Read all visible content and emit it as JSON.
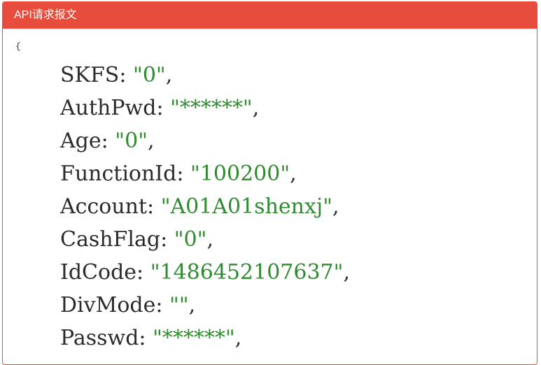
{
  "panel": {
    "title": "API请求报文",
    "accent_color": "#e74c3c"
  },
  "json": {
    "open_brace": "{",
    "string_color": "#2e8b2e",
    "lines": [
      {
        "key": "SKFS",
        "value": "0"
      },
      {
        "key": "AuthPwd",
        "value": "******"
      },
      {
        "key": "Age",
        "value": "0"
      },
      {
        "key": "FunctionId",
        "value": "100200"
      },
      {
        "key": "Account",
        "value": "A01A01shenxj"
      },
      {
        "key": "CashFlag",
        "value": "0"
      },
      {
        "key": "IdCode",
        "value": "1486452107637"
      },
      {
        "key": "DivMode",
        "value": ""
      },
      {
        "key": "Passwd",
        "value": "******"
      }
    ]
  }
}
